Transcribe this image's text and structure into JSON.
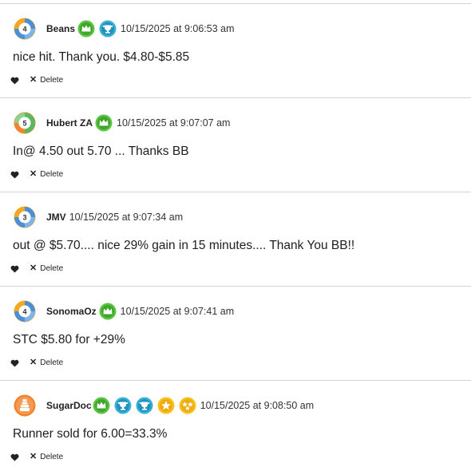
{
  "comments": [
    {
      "username": "Beans",
      "level": "4",
      "avatar_colors": [
        "#4a90d9",
        "#f5a623"
      ],
      "badges": [
        "crown-green",
        "trophy-blue"
      ],
      "timestamp": "10/15/2025 at 9:06:53 am",
      "text": "nice hit. Thank you. $4.80-$5.85",
      "delete_label": "Delete"
    },
    {
      "username": "Hubert ZA",
      "level": "5",
      "avatar_colors": [
        "#5cb85c",
        "#f0852d"
      ],
      "badges": [
        "crown-green"
      ],
      "timestamp": "10/15/2025 at 9:07:07 am",
      "text": "In@ 4.50 out 5.70 ... Thanks BB",
      "delete_label": "Delete"
    },
    {
      "username": "JMV",
      "level": "3",
      "avatar_colors": [
        "#4a90d9",
        "#f5a623"
      ],
      "badges": [],
      "timestamp": "10/15/2025 at 9:07:34 am",
      "text": "out @ $5.70.... nice 29% gain in 15 minutes.... Thank You BB!!",
      "delete_label": "Delete"
    },
    {
      "username": "SonomaOz",
      "level": "4",
      "avatar_colors": [
        "#4a90d9",
        "#f5a623"
      ],
      "badges": [
        "crown-green"
      ],
      "timestamp": "10/15/2025 at 9:07:41 am",
      "text": "STC $5.80 for +29%",
      "delete_label": "Delete"
    },
    {
      "username": "SugarDoc",
      "level": "",
      "avatar_colors": [
        "#f0852d",
        "#ffffff"
      ],
      "badges": [
        "crown-green",
        "trophy-blue",
        "trophy-blue",
        "star-gold",
        "stars-gold"
      ],
      "timestamp": "10/15/2025 at 9:08:50 am",
      "text": "Runner sold for 6.00=33.3%",
      "delete_label": "Delete"
    }
  ]
}
